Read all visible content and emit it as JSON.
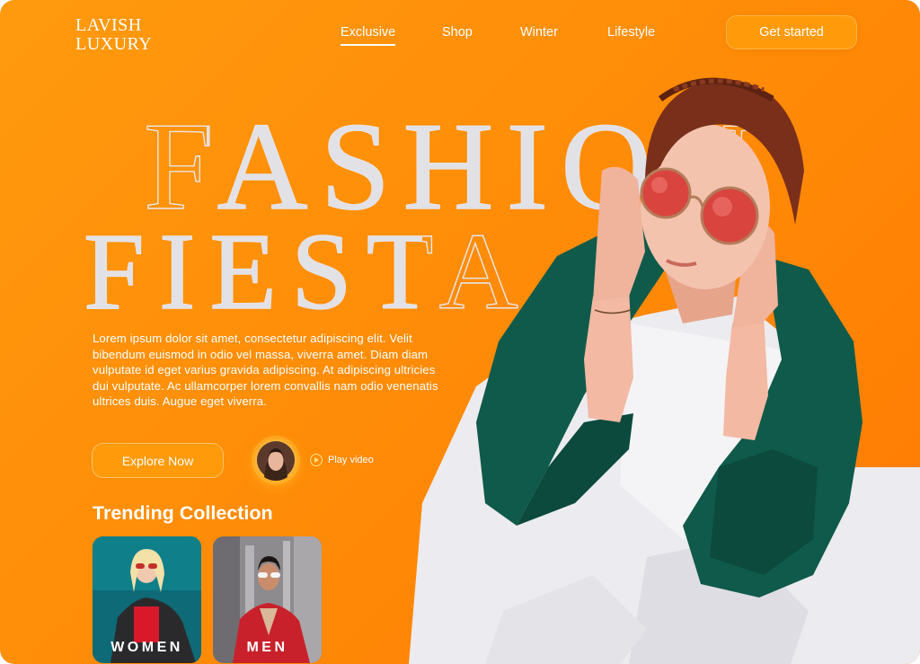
{
  "brand": {
    "logo_line1": "LAVISH",
    "logo_line2": "LUXURY"
  },
  "nav": {
    "items": [
      {
        "label": "Exclusive",
        "active": true
      },
      {
        "label": "Shop",
        "active": false
      },
      {
        "label": "Winter",
        "active": false
      },
      {
        "label": "Lifestyle",
        "active": false
      }
    ],
    "cta_label": "Get started"
  },
  "hero": {
    "headline_line1": "FASHION",
    "headline_line2": "FIESTA",
    "description": "Lorem ipsum dolor sit amet, consectetur adipiscing elit. Velit bibendum euismod in odio vel massa, viverra amet. Diam diam vulputate id eget varius gravida adipiscing. At adipiscing ultricies dui vulputate. Ac ullamcorper lorem convallis nam odio venenatis ultrices duis. Augue eget viverra.",
    "explore_label": "Explore Now",
    "play_label": "Play video"
  },
  "trending": {
    "title": "Trending Collection",
    "cards": [
      {
        "label": "WOMEN"
      },
      {
        "label": "MEN"
      }
    ]
  },
  "colors": {
    "background": "#ff8a07",
    "accent_button": "#ff9a0a",
    "headline": "#e2e1e6",
    "jacket": "#0f5a4a"
  },
  "icons": [
    "play-icon"
  ]
}
